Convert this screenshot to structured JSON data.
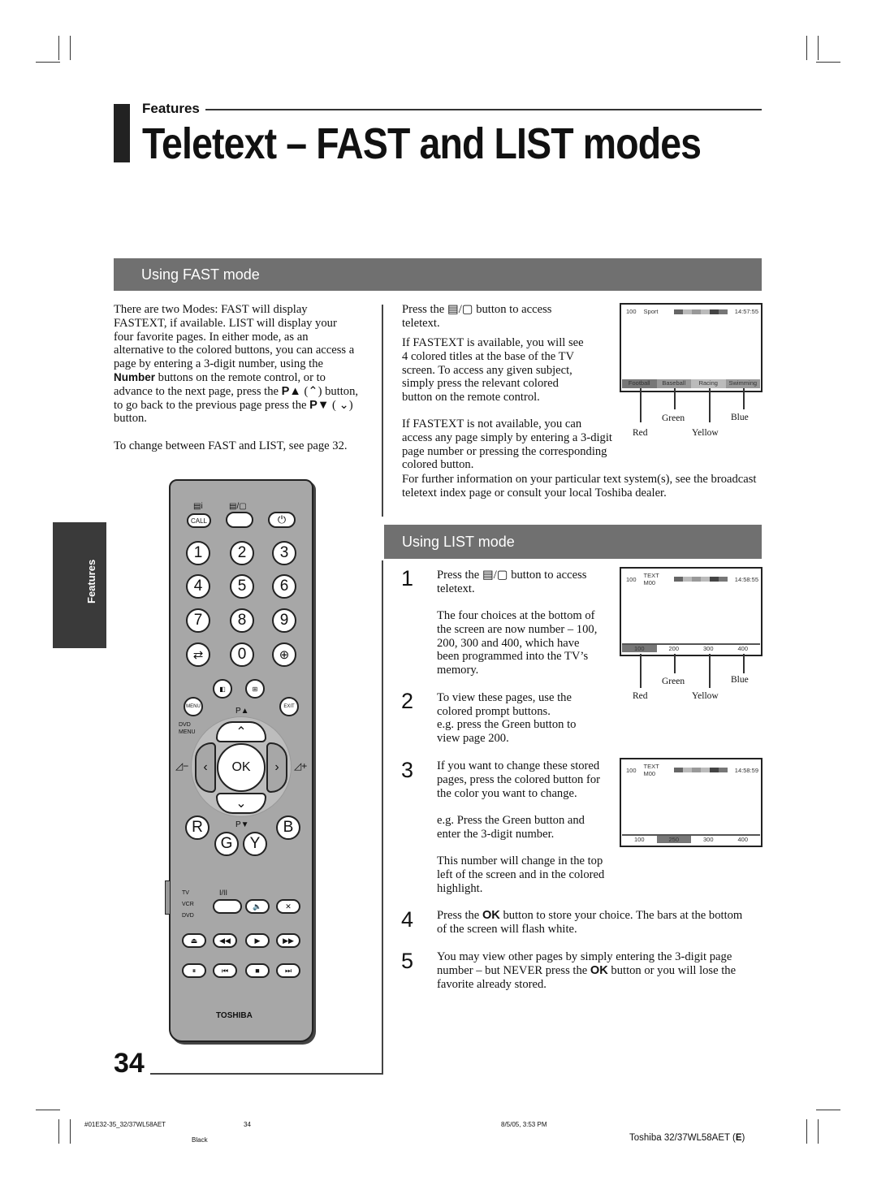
{
  "header": {
    "section": "Features",
    "title": "Teletext – FAST and LIST modes"
  },
  "side_tab": "Features",
  "fast": {
    "heading": "Using FAST mode",
    "intro_pre": "There are two Modes: FAST will display FASTEXT, if available. LIST will display your four favorite pages. In either mode, as an alternative to the colored buttons, you can access a page by entering a 3-digit number, using the ",
    "intro_bold": "Number",
    "intro_mid": " buttons on the remote control, or to advance to the next page, press the ",
    "p_up": "P▲",
    "intro_mid2": " (⌃) button, to go back to the previous page press the ",
    "p_down": "P▼",
    "intro_end": " ( ⌄) button.",
    "see_page": "To change between FAST and LIST, see page 32.",
    "col2": [
      "Press the ▤/▢ button to access teletext.",
      "If FASTEXT is available, you will see 4 colored titles at the base of the TV screen. To access any given subject, simply press the relevant colored button on the remote control.",
      "If FASTEXT is not available, you can access any page simply by entering a 3-digit page number or pressing the corresponding colored button."
    ],
    "further": "For further information on your particular text system(s), see the broadcast teletext index page or consult your local Toshiba dealer.",
    "screen": {
      "page": "100",
      "name": "Sport",
      "time": "14:57:55",
      "tabs": [
        "Football",
        "Baseball",
        "Racing",
        "Swimming"
      ]
    }
  },
  "colors": {
    "red": "Red",
    "green": "Green",
    "yellow": "Yellow",
    "blue": "Blue"
  },
  "list": {
    "heading": "Using LIST mode",
    "steps": [
      {
        "n": "1",
        "text": "Press the ▤/▢ button to access teletext.",
        "text2": "The four choices at the bottom of the screen are now number – 100, 200, 300 and 400, which have been programmed into the TV’s memory."
      },
      {
        "n": "2",
        "text": "To view these pages, use the colored prompt buttons.",
        "text2": "e.g. press the Green button to view page 200."
      },
      {
        "n": "3",
        "text": "If you want to change these stored pages, press the colored button for the color you want to change.",
        "text2": "e.g. Press the Green button and enter the 3-digit number.",
        "text3": "This number will change in the top left of the screen and in the colored highlight."
      },
      {
        "n": "4",
        "pre": "Press the ",
        "bold": "OK",
        "post": " button to store your choice. The bars at the bottom of the screen will flash white."
      },
      {
        "n": "5",
        "pre": "You may view other pages by simply entering the 3-digit page number – but NEVER press the ",
        "bold": "OK",
        "post": " button or you will lose the favorite already stored."
      }
    ],
    "screen1": {
      "page": "100",
      "mode": "TEXT",
      "sub": "M00",
      "time": "14:58:55",
      "tabs": [
        "100",
        "200",
        "300",
        "400"
      ]
    },
    "screen2": {
      "page": "100",
      "mode": "TEXT",
      "sub": "M00",
      "time": "14:58:59",
      "tabs": [
        "100",
        "250",
        "300",
        "400"
      ]
    }
  },
  "remote": {
    "call": "CALL",
    "nums": [
      "1",
      "2",
      "3",
      "4",
      "5",
      "6",
      "7",
      "8",
      "9",
      "0"
    ],
    "menu": "MENU",
    "exit": "EXIT",
    "p_up": "P▲",
    "p_down": "P▼",
    "dvd_menu": "DVD MENU",
    "ok": "OK",
    "r": "R",
    "g": "G",
    "y": "Y",
    "b": "B",
    "tv": "TV",
    "vcr": "VCR",
    "dvd": "DVD",
    "dual": "I/II",
    "brand": "TOSHIBA"
  },
  "page_number": "34",
  "footer": {
    "file": "#01E32-35_32/37WL58AET",
    "page": "34",
    "date": "8/5/05, 3:53 PM",
    "ink": "Black",
    "model_pre": "Toshiba 32/37WL58AET (",
    "model_bold": "E",
    "model_post": ")"
  }
}
